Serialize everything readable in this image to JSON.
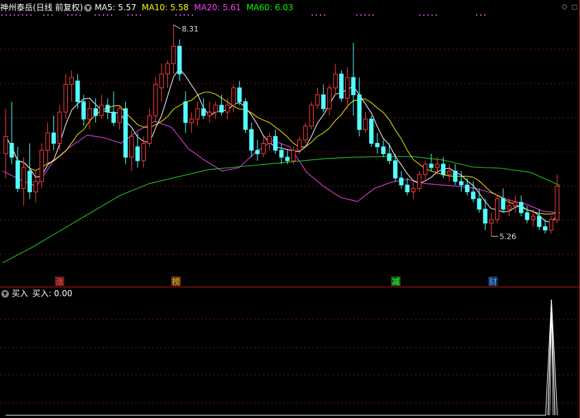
{
  "header": {
    "stock_name": "神州泰岳",
    "period_label": "(日线 前复权)",
    "indicators": [
      {
        "label": "MA5: 5.57",
        "color": "#ffffff"
      },
      {
        "label": "MA10: 5.58",
        "color": "#ffff00"
      },
      {
        "label": "MA20: 5.61",
        "color": "#ff40ff"
      },
      {
        "label": "MA60: 6.03",
        "color": "#00ff00"
      }
    ]
  },
  "sub_header": {
    "indicator_name": "买入",
    "value_label": "买入: 0.00"
  },
  "annotations": {
    "high_label": "8.31",
    "low_label": "5.26"
  },
  "event_markers": [
    {
      "label": "涨",
      "color": "#ff5050",
      "bg": "#5a1a1a"
    },
    {
      "label": "榜",
      "color": "#ffa040",
      "bg": "#5a3a10"
    },
    {
      "label": "减",
      "color": "#40ff40",
      "bg": "#105a10"
    },
    {
      "label": "财",
      "color": "#60a0ff",
      "bg": "#10305a"
    }
  ],
  "icons": {
    "dropdown": "chevron-down-icon",
    "diamond": "diamond-icon",
    "box": "square-icon"
  },
  "chart_data": [
    {
      "type": "candlestick",
      "title": "神州泰岳",
      "price_range": [
        4.8,
        8.45
      ],
      "grid": true,
      "high_value": 8.31,
      "low_value": 5.26,
      "ma": {
        "MA5": 5.57,
        "MA10": 5.58,
        "MA20": 5.61,
        "MA60": 6.03
      },
      "ma60_series": [
        4.88,
        5.1,
        5.35,
        5.6,
        5.85,
        6.02,
        6.12,
        6.22,
        6.26,
        6.3,
        6.34,
        6.38,
        6.4,
        6.41,
        6.41,
        6.36,
        6.26,
        6.24,
        6.18,
        5.99
      ],
      "ma20_series": [
        6.2,
        6.08,
        5.98,
        6.35,
        6.55,
        6.72,
        6.68,
        6.6,
        6.78,
        6.92,
        6.83,
        6.52,
        6.35,
        6.2,
        6.25,
        6.48,
        6.64,
        6.55,
        6.18,
        5.98,
        5.82,
        5.76,
        5.95,
        6.04,
        6.08,
        6.02,
        6.0,
        5.98,
        5.95,
        5.88,
        5.78,
        5.72,
        5.62,
        5.6
      ],
      "candles": [
        {
          "o": 6.45,
          "h": 7.1,
          "l": 6.1,
          "c": 6.7
        },
        {
          "o": 6.6,
          "h": 7.2,
          "l": 6.3,
          "c": 6.4
        },
        {
          "o": 6.35,
          "h": 6.55,
          "l": 5.9,
          "c": 5.95
        },
        {
          "o": 5.95,
          "h": 6.4,
          "l": 5.7,
          "c": 6.25
        },
        {
          "o": 6.2,
          "h": 6.6,
          "l": 5.8,
          "c": 5.9
        },
        {
          "o": 5.9,
          "h": 6.2,
          "l": 5.75,
          "c": 6.05
        },
        {
          "o": 6.05,
          "h": 6.6,
          "l": 5.95,
          "c": 6.5
        },
        {
          "o": 6.5,
          "h": 6.9,
          "l": 6.3,
          "c": 6.75
        },
        {
          "o": 6.75,
          "h": 7.0,
          "l": 6.5,
          "c": 6.6
        },
        {
          "o": 6.6,
          "h": 7.15,
          "l": 6.5,
          "c": 7.05
        },
        {
          "o": 7.05,
          "h": 7.6,
          "l": 6.95,
          "c": 7.45
        },
        {
          "o": 7.45,
          "h": 7.65,
          "l": 7.2,
          "c": 7.55
        },
        {
          "o": 7.5,
          "h": 7.6,
          "l": 7.1,
          "c": 7.2
        },
        {
          "o": 7.2,
          "h": 7.3,
          "l": 6.85,
          "c": 6.95
        },
        {
          "o": 6.95,
          "h": 7.2,
          "l": 6.8,
          "c": 7.1
        },
        {
          "o": 7.1,
          "h": 7.25,
          "l": 6.9,
          "c": 7.0
        },
        {
          "o": 7.0,
          "h": 7.3,
          "l": 6.95,
          "c": 7.15
        },
        {
          "o": 7.15,
          "h": 7.25,
          "l": 6.95,
          "c": 7.05
        },
        {
          "o": 7.05,
          "h": 7.35,
          "l": 6.85,
          "c": 6.9
        },
        {
          "o": 6.9,
          "h": 7.15,
          "l": 6.8,
          "c": 7.1
        },
        {
          "o": 7.1,
          "h": 7.2,
          "l": 6.3,
          "c": 6.4
        },
        {
          "o": 6.4,
          "h": 6.8,
          "l": 6.2,
          "c": 6.7
        },
        {
          "o": 6.55,
          "h": 6.75,
          "l": 6.25,
          "c": 6.35
        },
        {
          "o": 6.35,
          "h": 6.7,
          "l": 6.25,
          "c": 6.6
        },
        {
          "o": 6.6,
          "h": 7.1,
          "l": 6.55,
          "c": 7.0
        },
        {
          "o": 7.0,
          "h": 7.55,
          "l": 6.9,
          "c": 7.45
        },
        {
          "o": 7.4,
          "h": 7.75,
          "l": 7.2,
          "c": 7.6
        },
        {
          "o": 7.6,
          "h": 7.8,
          "l": 7.4,
          "c": 7.75
        },
        {
          "o": 7.75,
          "h": 8.31,
          "l": 7.6,
          "c": 8.0
        },
        {
          "o": 8.0,
          "h": 8.1,
          "l": 7.5,
          "c": 7.6
        },
        {
          "o": 7.2,
          "h": 7.35,
          "l": 6.75,
          "c": 6.9
        },
        {
          "o": 6.9,
          "h": 7.05,
          "l": 6.75,
          "c": 6.95
        },
        {
          "o": 6.95,
          "h": 7.2,
          "l": 6.85,
          "c": 7.1
        },
        {
          "o": 7.1,
          "h": 7.25,
          "l": 6.95,
          "c": 7.0
        },
        {
          "o": 7.0,
          "h": 7.2,
          "l": 6.9,
          "c": 7.05
        },
        {
          "o": 7.05,
          "h": 7.2,
          "l": 6.95,
          "c": 7.15
        },
        {
          "o": 7.15,
          "h": 7.3,
          "l": 7.0,
          "c": 7.05
        },
        {
          "o": 7.05,
          "h": 7.25,
          "l": 6.95,
          "c": 7.15
        },
        {
          "o": 7.15,
          "h": 7.45,
          "l": 7.05,
          "c": 7.4
        },
        {
          "o": 7.4,
          "h": 7.5,
          "l": 7.15,
          "c": 7.2
        },
        {
          "o": 7.2,
          "h": 7.25,
          "l": 6.75,
          "c": 6.8
        },
        {
          "o": 6.8,
          "h": 6.9,
          "l": 6.4,
          "c": 6.5
        },
        {
          "o": 6.5,
          "h": 6.65,
          "l": 6.35,
          "c": 6.45
        },
        {
          "o": 6.45,
          "h": 6.7,
          "l": 6.4,
          "c": 6.6
        },
        {
          "o": 6.6,
          "h": 6.75,
          "l": 6.5,
          "c": 6.7
        },
        {
          "o": 6.7,
          "h": 6.8,
          "l": 6.45,
          "c": 6.5
        },
        {
          "o": 6.5,
          "h": 6.6,
          "l": 6.3,
          "c": 6.4
        },
        {
          "o": 6.4,
          "h": 6.5,
          "l": 6.3,
          "c": 6.35
        },
        {
          "o": 6.35,
          "h": 6.55,
          "l": 6.3,
          "c": 6.5
        },
        {
          "o": 6.5,
          "h": 6.7,
          "l": 6.45,
          "c": 6.65
        },
        {
          "o": 6.65,
          "h": 6.9,
          "l": 6.6,
          "c": 6.85
        },
        {
          "o": 6.85,
          "h": 7.2,
          "l": 6.8,
          "c": 7.15
        },
        {
          "o": 7.15,
          "h": 7.4,
          "l": 7.1,
          "c": 7.3
        },
        {
          "o": 7.3,
          "h": 7.45,
          "l": 7.05,
          "c": 7.1
        },
        {
          "o": 7.1,
          "h": 7.45,
          "l": 7.0,
          "c": 7.4
        },
        {
          "o": 7.4,
          "h": 7.75,
          "l": 7.3,
          "c": 7.6
        },
        {
          "o": 7.6,
          "h": 7.65,
          "l": 7.2,
          "c": 7.25
        },
        {
          "o": 7.25,
          "h": 7.7,
          "l": 7.1,
          "c": 7.55
        },
        {
          "o": 7.55,
          "h": 8.05,
          "l": 7.0,
          "c": 7.3
        },
        {
          "o": 7.3,
          "h": 7.55,
          "l": 6.7,
          "c": 6.8
        },
        {
          "o": 6.8,
          "h": 7.05,
          "l": 6.75,
          "c": 6.95
        },
        {
          "o": 6.95,
          "h": 7.0,
          "l": 6.55,
          "c": 6.6
        },
        {
          "o": 6.6,
          "h": 6.75,
          "l": 6.45,
          "c": 6.55
        },
        {
          "o": 6.55,
          "h": 6.65,
          "l": 6.4,
          "c": 6.45
        },
        {
          "o": 6.45,
          "h": 6.6,
          "l": 6.3,
          "c": 6.35
        },
        {
          "o": 6.35,
          "h": 6.45,
          "l": 6.05,
          "c": 6.1
        },
        {
          "o": 6.1,
          "h": 6.2,
          "l": 5.95,
          "c": 6.0
        },
        {
          "o": 6.0,
          "h": 6.1,
          "l": 5.85,
          "c": 5.9
        },
        {
          "o": 5.9,
          "h": 6.05,
          "l": 5.8,
          "c": 5.95
        },
        {
          "o": 5.95,
          "h": 6.2,
          "l": 5.9,
          "c": 6.15
        },
        {
          "o": 6.15,
          "h": 6.35,
          "l": 6.05,
          "c": 6.3
        },
        {
          "o": 6.3,
          "h": 6.45,
          "l": 6.2,
          "c": 6.25
        },
        {
          "o": 6.25,
          "h": 6.4,
          "l": 6.15,
          "c": 6.3
        },
        {
          "o": 6.3,
          "h": 6.4,
          "l": 6.1,
          "c": 6.15
        },
        {
          "o": 6.15,
          "h": 6.3,
          "l": 6.05,
          "c": 6.2
        },
        {
          "o": 6.2,
          "h": 6.3,
          "l": 6.0,
          "c": 6.05
        },
        {
          "o": 6.05,
          "h": 6.2,
          "l": 5.9,
          "c": 6.0
        },
        {
          "o": 6.0,
          "h": 6.1,
          "l": 5.85,
          "c": 5.9
        },
        {
          "o": 5.9,
          "h": 6.05,
          "l": 5.75,
          "c": 5.8
        },
        {
          "o": 5.8,
          "h": 5.95,
          "l": 5.6,
          "c": 5.65
        },
        {
          "o": 5.65,
          "h": 5.8,
          "l": 5.35,
          "c": 5.45
        },
        {
          "o": 5.45,
          "h": 5.6,
          "l": 5.26,
          "c": 5.5
        },
        {
          "o": 5.5,
          "h": 5.85,
          "l": 5.45,
          "c": 5.8
        },
        {
          "o": 5.8,
          "h": 5.95,
          "l": 5.6,
          "c": 5.65
        },
        {
          "o": 5.65,
          "h": 5.8,
          "l": 5.55,
          "c": 5.7
        },
        {
          "o": 5.7,
          "h": 5.85,
          "l": 5.6,
          "c": 5.75
        },
        {
          "o": 5.75,
          "h": 5.85,
          "l": 5.55,
          "c": 5.6
        },
        {
          "o": 5.6,
          "h": 5.7,
          "l": 5.45,
          "c": 5.5
        },
        {
          "o": 5.5,
          "h": 5.65,
          "l": 5.4,
          "c": 5.55
        },
        {
          "o": 5.55,
          "h": 5.65,
          "l": 5.35,
          "c": 5.4
        },
        {
          "o": 5.4,
          "h": 5.5,
          "l": 5.3,
          "c": 5.35
        },
        {
          "o": 5.35,
          "h": 5.55,
          "l": 5.3,
          "c": 5.5
        },
        {
          "o": 5.5,
          "h": 6.15,
          "l": 5.45,
          "c": 5.98
        }
      ]
    },
    {
      "type": "line",
      "title": "买入",
      "range": [
        0,
        1
      ],
      "grid": true,
      "values": [
        0,
        0,
        0,
        0,
        0,
        0,
        0,
        0,
        0,
        0,
        0,
        0,
        0,
        0,
        0,
        0,
        0,
        0,
        0,
        0,
        0,
        0,
        0,
        0,
        0,
        0,
        0,
        0,
        0,
        0,
        0,
        0,
        0,
        0,
        0,
        0,
        0,
        0,
        0,
        0,
        0,
        0,
        0,
        0,
        0,
        0,
        0,
        0,
        0,
        0,
        0,
        0,
        0,
        0,
        0,
        0,
        0,
        0,
        0,
        0,
        0,
        0,
        0,
        0,
        0,
        0,
        0,
        0,
        0,
        0,
        0,
        0,
        0,
        0,
        0,
        0,
        0,
        0,
        0,
        0,
        0,
        0,
        0,
        0,
        0,
        0,
        0,
        0,
        0,
        0,
        0,
        0,
        0,
        0,
        1,
        0
      ]
    }
  ]
}
